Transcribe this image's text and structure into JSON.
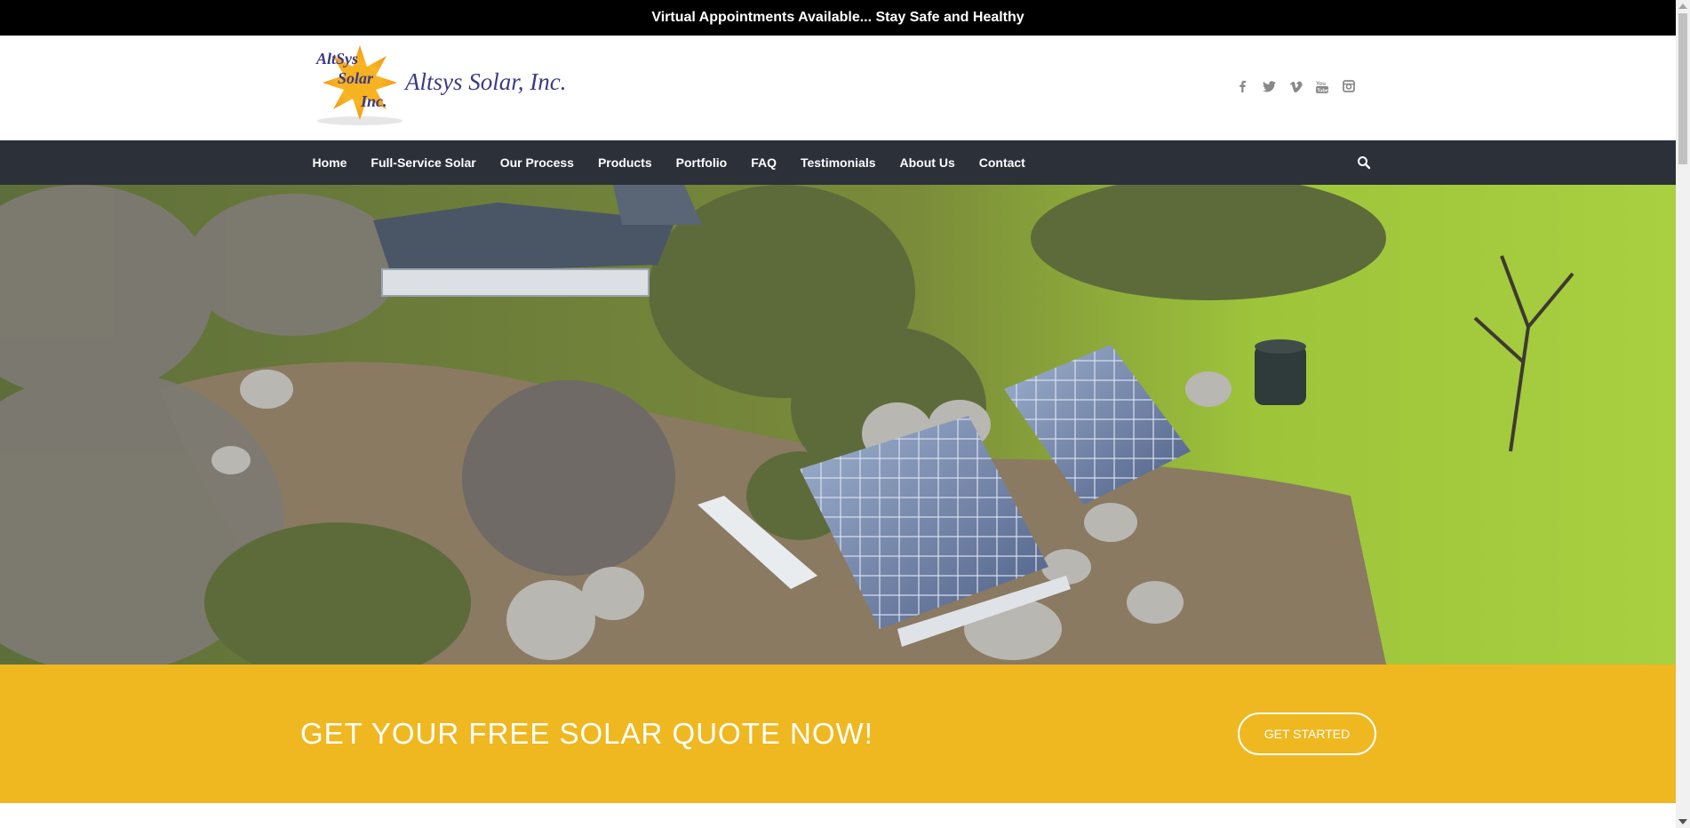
{
  "announcement": "Virtual Appointments Available... Stay Safe and Healthy",
  "logo": {
    "mark_lines": [
      "AltSys",
      "Solar",
      "Inc."
    ],
    "name": "Altsys Solar, Inc."
  },
  "social_icons": [
    "facebook-icon",
    "twitter-icon",
    "vimeo-icon",
    "youtube-icon",
    "instagram-icon"
  ],
  "nav": {
    "items": [
      "Home",
      "Full-Service Solar",
      "Our Process",
      "Products",
      "Portfolio",
      "FAQ",
      "Testimonials",
      "About Us",
      "Contact"
    ]
  },
  "cta": {
    "headline": "GET YOUR FREE SOLAR QUOTE NOW!",
    "button": "GET STARTED"
  },
  "colors": {
    "topbar": "#000000",
    "nav_bg": "#2b3039",
    "cta_bg": "#efb821",
    "logo_text": "#3b3a85"
  }
}
